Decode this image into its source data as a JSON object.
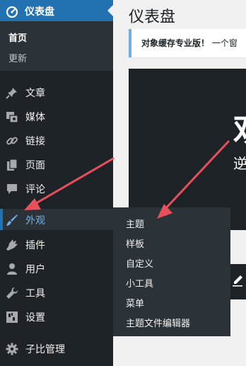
{
  "sidebar": {
    "current": {
      "label": "仪表盘",
      "icon": "dashboard-icon"
    },
    "submenu": [
      {
        "label": "首页"
      },
      {
        "label": "更新"
      }
    ],
    "items": [
      {
        "label": "文章",
        "icon": "pin-icon"
      },
      {
        "label": "媒体",
        "icon": "media-icon"
      },
      {
        "label": "链接",
        "icon": "link-icon"
      },
      {
        "label": "页面",
        "icon": "pages-icon"
      },
      {
        "label": "评论",
        "icon": "comment-icon"
      },
      {
        "label": "外观",
        "icon": "brush-icon",
        "active": true
      },
      {
        "label": "插件",
        "icon": "plugin-icon"
      },
      {
        "label": "用户",
        "icon": "user-icon"
      },
      {
        "label": "工具",
        "icon": "wrench-icon"
      },
      {
        "label": "设置",
        "icon": "settings-icon"
      },
      {
        "label": "子比管理",
        "icon": "gear-icon"
      }
    ]
  },
  "flyout": {
    "items": [
      {
        "label": "主题"
      },
      {
        "label": "样板"
      },
      {
        "label": "自定义"
      },
      {
        "label": "小工具"
      },
      {
        "label": "菜单"
      },
      {
        "label": "主题文件编辑器"
      }
    ]
  },
  "main": {
    "title": "仪表盘",
    "notice": {
      "bold": "对象缓存专业版！",
      "text": "一个窗"
    },
    "welcome": {
      "heading": "欢",
      "subtext": "逆"
    }
  },
  "colors": {
    "sidebar_bg": "#1d2327",
    "submenu_bg": "#2c3338",
    "accent": "#2271b1",
    "active_text": "#72aee6",
    "annotation_arrow": "#e8505b"
  }
}
